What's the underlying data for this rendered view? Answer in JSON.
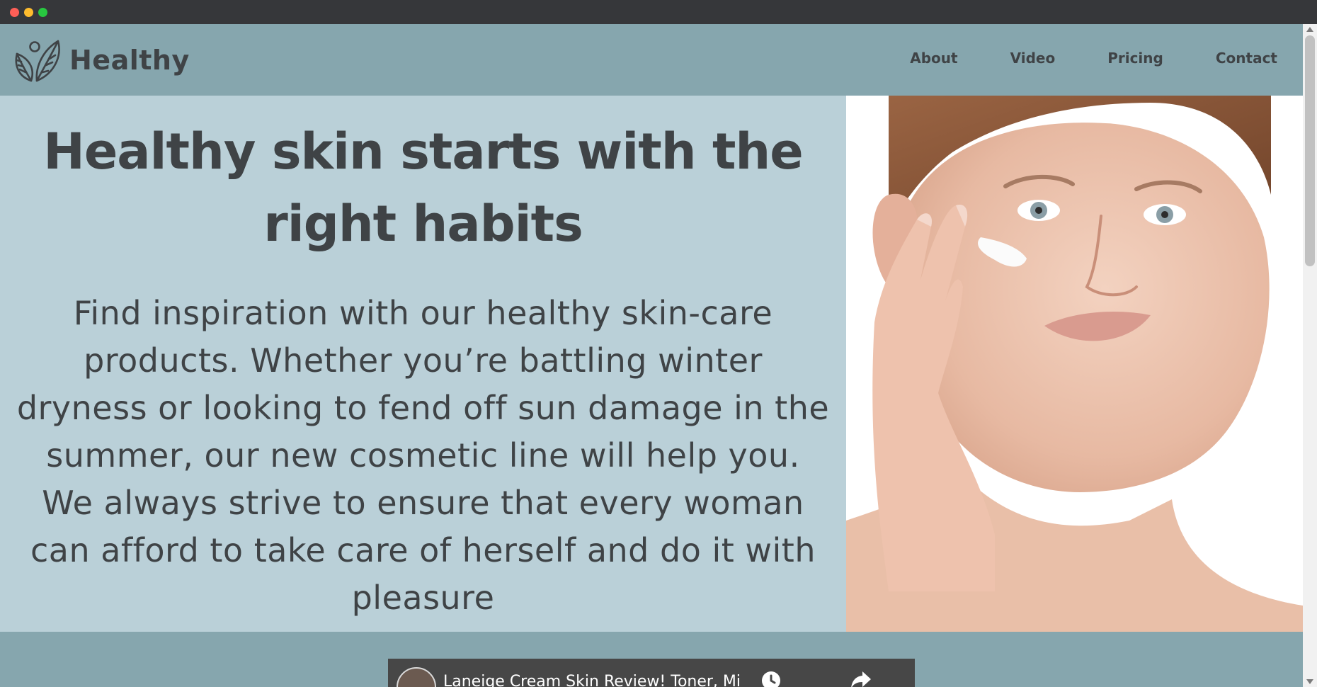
{
  "brand": {
    "name": "Healthy"
  },
  "nav": {
    "items": [
      "About",
      "Video",
      "Pricing",
      "Contact"
    ]
  },
  "hero": {
    "title": "Healthy skin starts with the right habits",
    "body": "Find inspiration with our healthy skin-care products. Whether you’re battling winter dryness or looking to fend off sun damage in the summer, our new cosmetic line will help you. We always strive to ensure that every woman can afford to take care of herself and do it with pleasure"
  },
  "video": {
    "title": "Laneige Cream Skin Review! Toner, Mi"
  },
  "colors": {
    "header_bg": "#86a6ae",
    "hero_bg": "#bad0d8",
    "text": "#3f4346"
  },
  "icons": [
    "leaf-logo-icon",
    "clock-icon",
    "share-icon"
  ]
}
